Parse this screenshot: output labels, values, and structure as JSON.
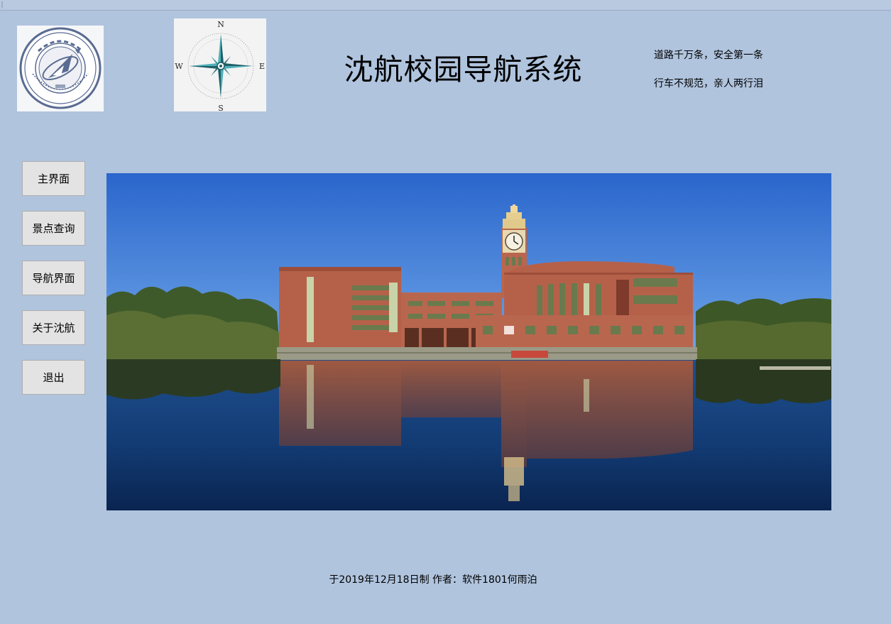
{
  "header": {
    "title": "沈航校园导航系统",
    "slogans": [
      "道路千万条，安全第一条",
      "行车不规范，亲人两行泪"
    ]
  },
  "logo": {
    "name": "university-seal",
    "seal_text": "沈阳航空航天大学",
    "seal_english": "SHENYANG AEROSPACE UNIVERSITY",
    "seal_year": "1952"
  },
  "compass": {
    "icon": "compass-rose-icon",
    "north": "N",
    "south": "S",
    "east": "E",
    "west": "W"
  },
  "nav": {
    "items": [
      {
        "label": "主界面"
      },
      {
        "label": "景点查询"
      },
      {
        "label": "导航界面"
      },
      {
        "label": "关于沈航"
      },
      {
        "label": "退出"
      }
    ]
  },
  "photo": {
    "subject": "campus-building-lake-reflection"
  },
  "footer": {
    "text": "于2019年12月18日制  作者：软件1801何雨泊"
  },
  "colors": {
    "background": "#b0c4de",
    "button_face": "#e3e3e3",
    "button_border": "#adadad",
    "brick": "#b5614a",
    "sky": "#2f72d4",
    "seal_blue": "#5a6b92"
  }
}
